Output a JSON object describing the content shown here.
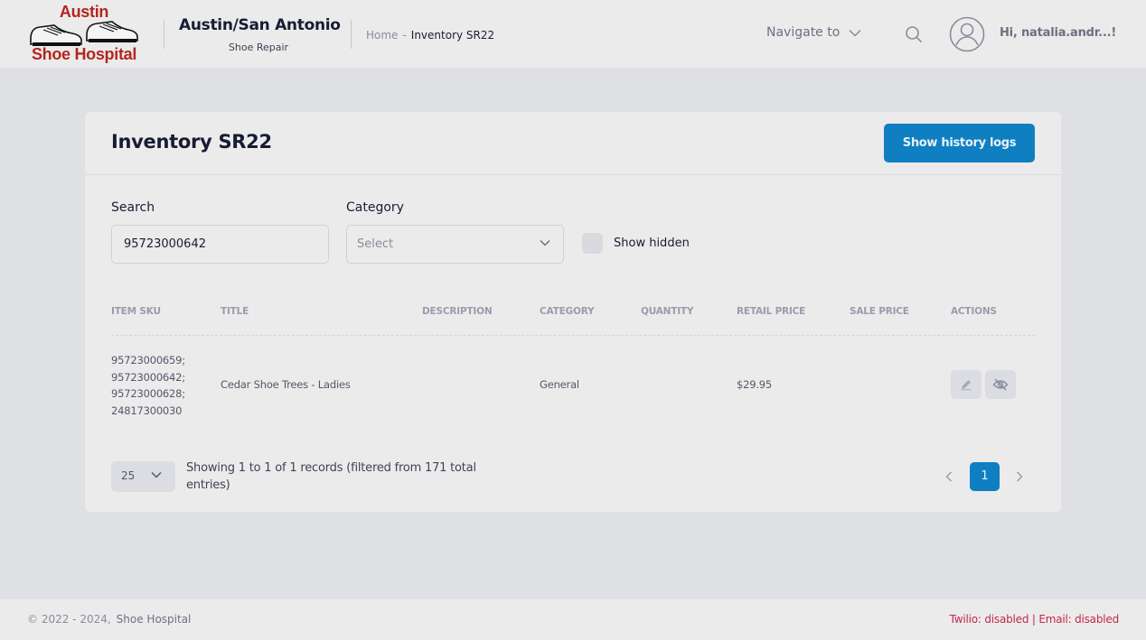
{
  "header": {
    "logo": {
      "line1": "Austin",
      "line2": "Shoe Hospital"
    },
    "brand_title": "Austin/San Antonio",
    "brand_subtitle": "Shoe Repair",
    "breadcrumb": {
      "home": "Home",
      "separator": "-",
      "current": "Inventory SR22"
    },
    "navigate_label": "Navigate to",
    "greeting": "Hi, natalia.andr...!"
  },
  "page": {
    "title": "Inventory SR22",
    "history_button": "Show history logs"
  },
  "filters": {
    "search_label": "Search",
    "search_value": "95723000642",
    "category_label": "Category",
    "category_placeholder": "Select",
    "show_hidden_label": "Show hidden",
    "show_hidden_checked": false
  },
  "table": {
    "headers": [
      "ITEM SKU",
      "TITLE",
      "DESCRIPTION",
      "CATEGORY",
      "QUANTITY",
      "RETAIL PRICE",
      "SALE PRICE",
      "ACTIONS"
    ],
    "rows": [
      {
        "sku_lines": [
          "95723000659;",
          "95723000642;",
          "95723000628;",
          "24817300030"
        ],
        "title": "Cedar Shoe Trees - Ladies",
        "description": "",
        "category": "General",
        "quantity": "",
        "retail_price": "$29.95",
        "sale_price": "",
        "actions": [
          "edit-icon",
          "eye-slash-icon"
        ]
      }
    ]
  },
  "pagination": {
    "page_size": "25",
    "records_info": "Showing 1 to 1 of 1 records (filtered from 171 total entries)",
    "current_page": "1"
  },
  "footer": {
    "copyright": "© 2022 - 2024,",
    "brand": "Shoe Hospital",
    "status": "Twilio: disabled | Email: disabled"
  },
  "colors": {
    "primary": "#0f7fc2",
    "logo_red": "#b3261e",
    "status_red": "#c2284a"
  }
}
